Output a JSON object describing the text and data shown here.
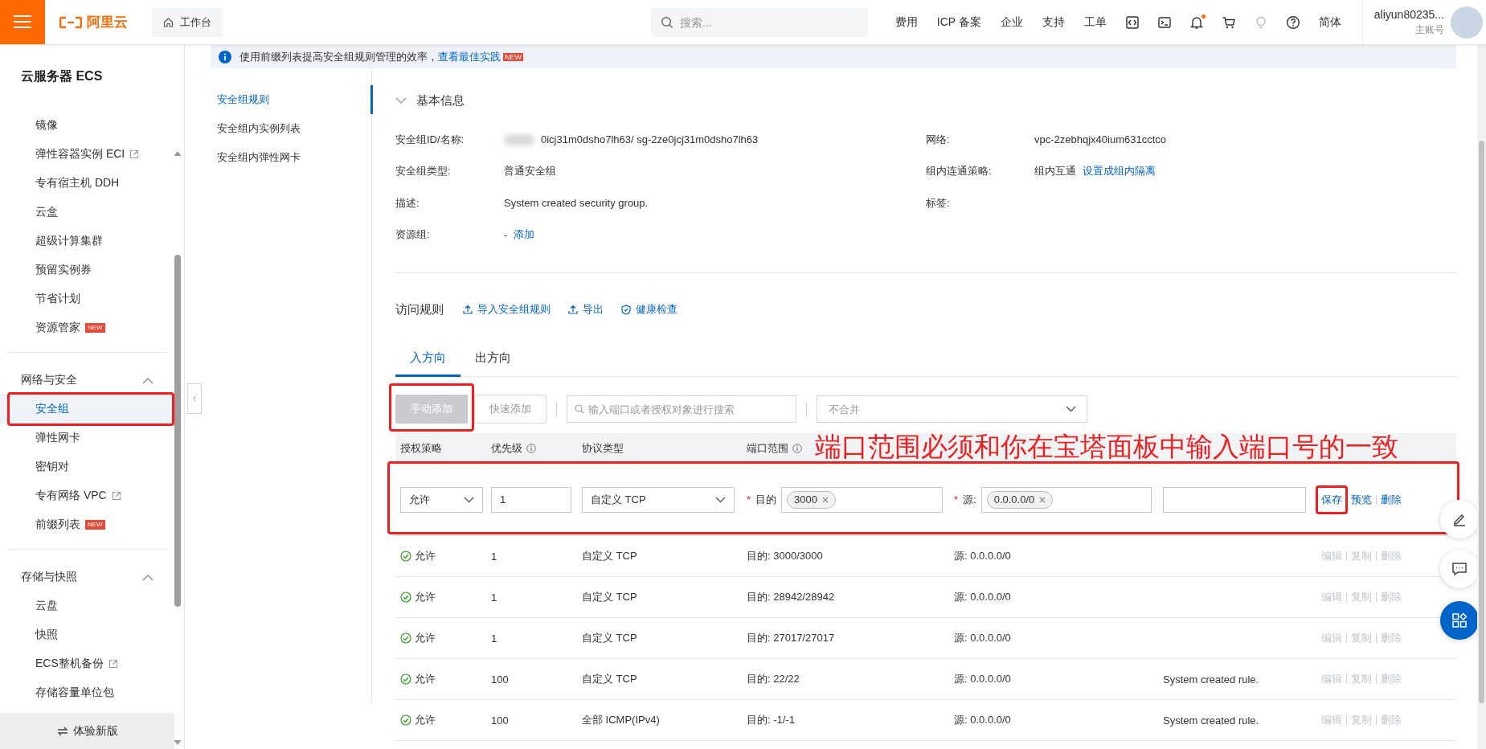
{
  "topbar": {
    "logo": "阿里云",
    "workbench": "工作台",
    "search": {
      "placeholder": "搜索..."
    },
    "links": [
      "费用",
      "ICP 备案",
      "企业",
      "支持",
      "工单"
    ],
    "icons": [
      {
        "kind": "code"
      },
      {
        "kind": "terminal"
      },
      {
        "kind": "bell"
      },
      {
        "kind": "cart"
      },
      {
        "kind": "bulb"
      },
      {
        "kind": "help"
      }
    ],
    "notifications_unread": true,
    "language": "简体",
    "user": {
      "name": "aliyun80235...",
      "role": "主账号"
    }
  },
  "sidebar": {
    "title": "云服务器 ECS",
    "groups": [
      {
        "items": [
          {
            "label": "镜像",
            "selected": false,
            "external": false,
            "highlighted": false
          },
          {
            "label": "弹性容器实例 ECI",
            "selected": false,
            "external": true,
            "highlighted": false
          },
          {
            "label": "专有宿主机 DDH",
            "selected": false,
            "external": false,
            "highlighted": false
          },
          {
            "label": "云盒",
            "selected": false,
            "external": false,
            "highlighted": false
          },
          {
            "label": "超级计算集群",
            "selected": false,
            "external": false,
            "highlighted": false
          },
          {
            "label": "预留实例券",
            "selected": false,
            "external": false,
            "highlighted": false
          },
          {
            "label": "节省计划",
            "selected": false,
            "external": false,
            "highlighted": false
          },
          {
            "label": "资源管家",
            "selected": false,
            "external": false,
            "highlighted": false,
            "badge": "NEW"
          }
        ]
      },
      {
        "heading": "网络与安全",
        "expanded": true,
        "items": [
          {
            "label": "安全组",
            "selected": true,
            "external": false,
            "highlighted": true
          },
          {
            "label": "弹性网卡",
            "selected": false,
            "external": false,
            "highlighted": false
          },
          {
            "label": "密钥对",
            "selected": false,
            "external": false,
            "highlighted": false
          },
          {
            "label": "专有网络 VPC",
            "selected": false,
            "external": true,
            "highlighted": false
          },
          {
            "label": "前缀列表",
            "selected": false,
            "external": false,
            "highlighted": false,
            "badge": "NEW"
          }
        ]
      },
      {
        "heading": "存储与快照",
        "expanded": true,
        "items": [
          {
            "label": "云盘",
            "selected": false,
            "external": false,
            "highlighted": false
          },
          {
            "label": "快照",
            "selected": false,
            "external": false,
            "highlighted": false
          },
          {
            "label": "ECS整机备份",
            "selected": false,
            "external": true,
            "highlighted": false
          },
          {
            "label": "存储容量单位包",
            "selected": false,
            "external": false,
            "highlighted": false
          }
        ]
      }
    ],
    "new_version": "体验新版"
  },
  "banner": {
    "text": "使用前缀列表提高安全组规则管理的效率，",
    "link": "查看最佳实践",
    "badge": "NEW"
  },
  "subnav": [
    {
      "label": "安全组规则",
      "selected": true
    },
    {
      "label": "安全组内实例列表",
      "selected": false
    },
    {
      "label": "安全组内弹性网卡",
      "selected": false
    }
  ],
  "basic_info": {
    "title": "基本信息",
    "expanded": true,
    "left": [
      {
        "label": "安全组ID/名称:",
        "value": "0icj31m0dsho7lh63/ sg-2ze0jcj31m0dsho7lh63",
        "redacted": true
      },
      {
        "label": "安全组类型:",
        "value": "普通安全组",
        "redacted": false
      },
      {
        "label": "描述:",
        "value": "System created security group.",
        "redacted": false
      },
      {
        "label": "资源组:",
        "value": "-",
        "link": "添加",
        "redacted": false
      }
    ],
    "right": [
      {
        "label": "网络:",
        "value": "vpc-2zebhqjx40ium631cctco",
        "redacted": false
      },
      {
        "label": "组内连通策略:",
        "value": "组内互通",
        "link": "设置成组内隔离",
        "redacted": false
      },
      {
        "label": "标签:",
        "redacted": false
      }
    ]
  },
  "rules": {
    "title": "访问规则",
    "actions": [
      {
        "label": "导入安全组规则"
      },
      {
        "label": "导出"
      },
      {
        "label": "健康检查"
      }
    ],
    "tabs": [
      {
        "label": "入方向",
        "selected": true
      },
      {
        "label": "出方向",
        "selected": false
      }
    ],
    "toolbar": {
      "buttons": [
        {
          "label": "手动添加",
          "kind": "primary",
          "disabled": true,
          "highlighted": true
        },
        {
          "label": "快速添加",
          "kind": "default",
          "disabled": true,
          "highlighted": false
        }
      ],
      "search": {
        "placeholder": "输入端口或者授权对象进行搜索"
      },
      "merge": {
        "placeholder": "不合并"
      }
    },
    "columns": [
      {
        "label": "授权策略",
        "info": false
      },
      {
        "label": "优先级",
        "info": true
      },
      {
        "label": "协议类型",
        "info": false
      },
      {
        "label": "端口范围",
        "info": true
      }
    ],
    "edit_row": {
      "highlighted": true,
      "policy": "允许",
      "priority": "1",
      "protocol": "自定义 TCP",
      "required_mark": "*",
      "dest_label": "目的",
      "dest_tags": [
        "3000"
      ],
      "source_label": "源:",
      "source_tags": [
        "0.0.0.0/0"
      ],
      "actions": [
        {
          "label": "保存",
          "disabled": false,
          "highlighted": true
        },
        {
          "label": "预览",
          "disabled": false,
          "highlighted": false
        },
        {
          "label": "删除",
          "disabled": false,
          "highlighted": false
        }
      ]
    },
    "rows": [
      {
        "policy": "允许",
        "priority": "1",
        "protocol": "自定义 TCP",
        "port": "目的: 3000/3000",
        "source": "源: 0.0.0.0/0",
        "actions": [
          {
            "label": "编辑",
            "disabled": true
          },
          {
            "label": "复制",
            "disabled": true
          },
          {
            "label": "删除",
            "disabled": true
          }
        ]
      },
      {
        "policy": "允许",
        "priority": "1",
        "protocol": "自定义 TCP",
        "port": "目的: 28942/28942",
        "source": "源: 0.0.0.0/0",
        "actions": [
          {
            "label": "编辑",
            "disabled": true
          },
          {
            "label": "复制",
            "disabled": true
          },
          {
            "label": "删除",
            "disabled": true
          }
        ]
      },
      {
        "policy": "允许",
        "priority": "1",
        "protocol": "自定义 TCP",
        "port": "目的: 27017/27017",
        "source": "源: 0.0.0.0/0",
        "actions": [
          {
            "label": "编辑",
            "disabled": true
          },
          {
            "label": "复制",
            "disabled": true
          },
          {
            "label": "删除",
            "disabled": true
          }
        ]
      },
      {
        "policy": "允许",
        "priority": "100",
        "protocol": "自定义 TCP",
        "port": "目的: 22/22",
        "source": "源: 0.0.0.0/0",
        "description": "System created rule.",
        "actions": [
          {
            "label": "编辑",
            "disabled": true
          },
          {
            "label": "复制",
            "disabled": true
          },
          {
            "label": "删除",
            "disabled": true
          }
        ]
      },
      {
        "policy": "允许",
        "priority": "100",
        "protocol": "全部 ICMP(IPv4)",
        "port": "目的: -1/-1",
        "source": "源: 0.0.0.0/0",
        "description": "System created rule.",
        "actions": [
          {
            "label": "编辑",
            "disabled": true
          },
          {
            "label": "复制",
            "disabled": true
          },
          {
            "label": "删除",
            "disabled": true
          }
        ]
      }
    ]
  },
  "annotation": {
    "text": "端口范围必须和你在宝塔面板中输入端口号的一致"
  }
}
